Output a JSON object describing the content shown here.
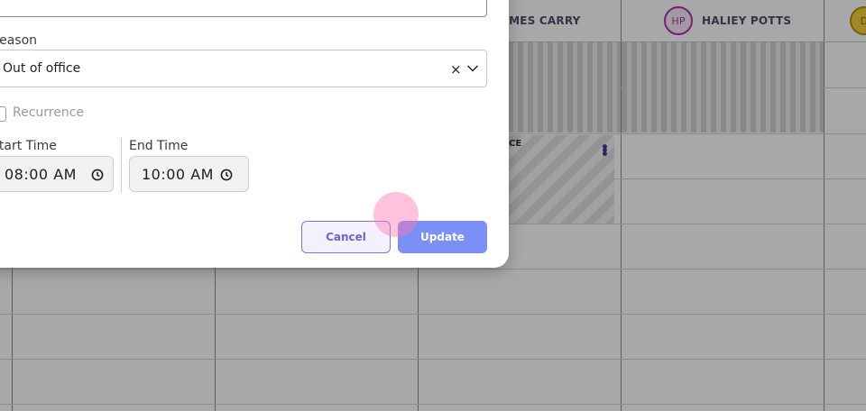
{
  "scheduler": {
    "columns": [
      {
        "name": "JAMES CARRY",
        "initials": ""
      },
      {
        "name": "HALIEY POTTS",
        "initials": "HP"
      },
      {
        "name": "",
        "initials": "D"
      }
    ],
    "event_label": "CE",
    "event_menu": "⋮"
  },
  "dialog": {
    "reason_label": "Reason",
    "reason_value": "Out of office",
    "clear_glyph": "×",
    "recurrence_label": "Recurrence",
    "start_time_label": "Start Time",
    "start_time_value": "08:00 AM",
    "end_time_label": "End Time",
    "end_time_value": "10:00 AM",
    "cancel_label": "Cancel",
    "update_label": "Update"
  }
}
